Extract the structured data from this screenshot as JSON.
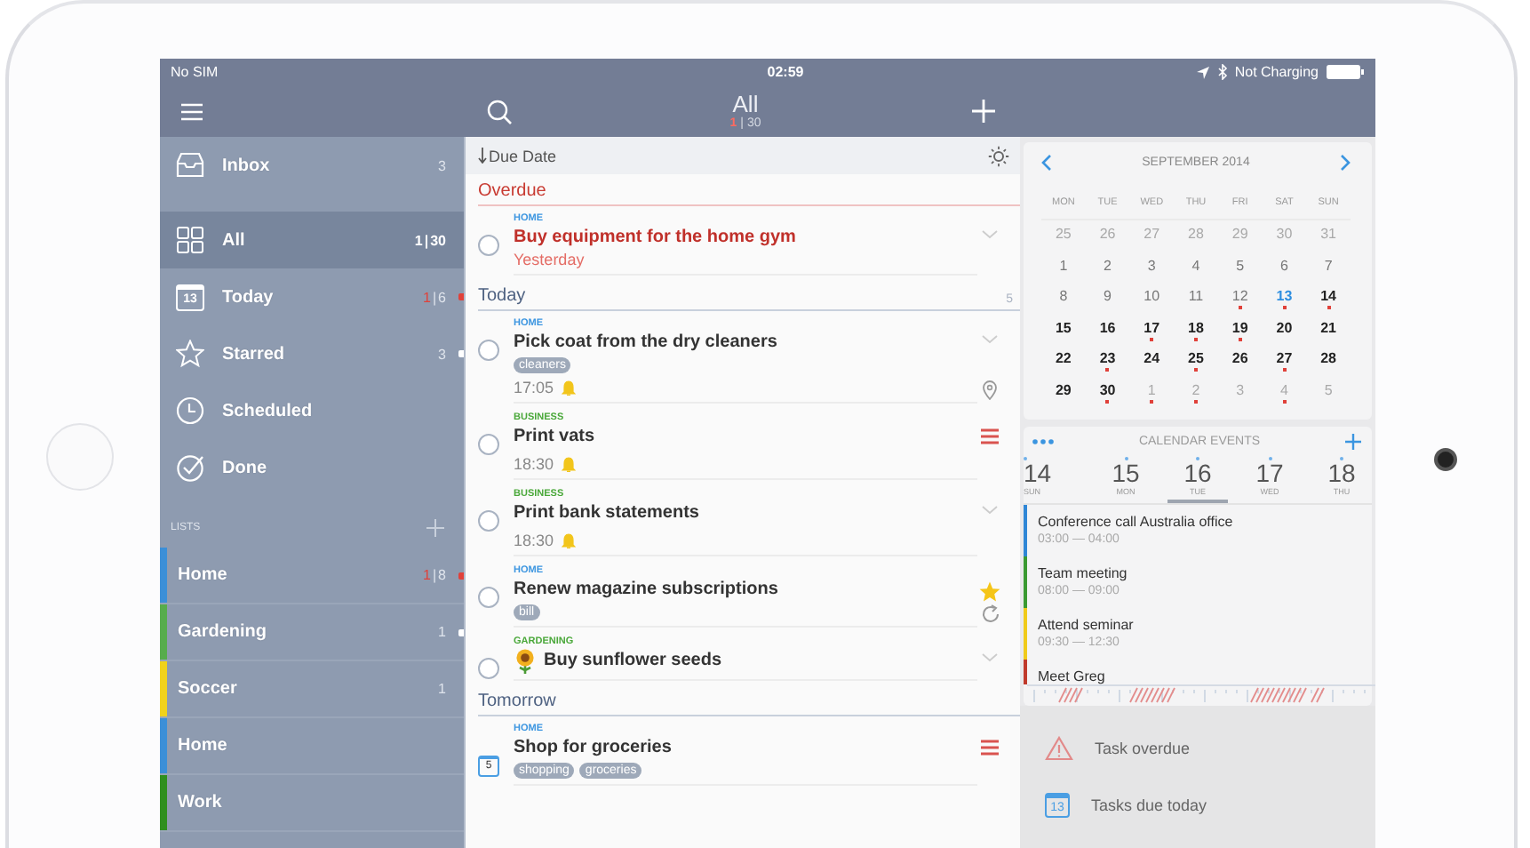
{
  "status_bar": {
    "carrier": "No SIM",
    "time": "02:59",
    "battery_text": "Not Charging"
  },
  "nav_bar": {
    "title": "All",
    "overdue": "1",
    "divider": "|",
    "count": "30"
  },
  "sidebar": {
    "items": [
      {
        "label": "Inbox",
        "selected": false,
        "count": "3",
        "overdue_marker": false,
        "count_marker": false
      },
      {
        "label": "All",
        "selected": true,
        "overdue": "1",
        "divider": "|",
        "count": "30",
        "overdue_marker": false,
        "count_marker": false
      },
      {
        "label": "Today",
        "icon_text": "13",
        "selected": false,
        "overdue": "1",
        "divider": "|",
        "count": "6",
        "overdue_marker": true,
        "count_marker": false
      },
      {
        "label": "Starred",
        "selected": false,
        "count": "3",
        "overdue_marker": false,
        "count_marker": true
      },
      {
        "label": "Scheduled",
        "selected": false,
        "overdue_marker": false,
        "count_marker": false
      },
      {
        "label": "Done",
        "selected": false,
        "overdue_marker": false,
        "count_marker": false
      }
    ],
    "lists_heading": "LISTS",
    "lists": [
      {
        "label": "Home",
        "color": "#3b8fd8",
        "selected": false,
        "overdue": "1",
        "divider": "|",
        "count": "8",
        "overdue_marker": true,
        "count_marker": false
      },
      {
        "label": "Gardening",
        "color": "#57ac4c",
        "selected": false,
        "count": "1",
        "overdue_marker": false,
        "count_marker": true
      },
      {
        "label": "Soccer",
        "color": "#f1d21b",
        "selected": false,
        "count": "1",
        "overdue_marker": false,
        "count_marker": false
      },
      {
        "label": "Home",
        "color": "#3b8fd8",
        "selected": false,
        "overdue_marker": false,
        "count_marker": false
      },
      {
        "label": "Work",
        "color": "#2f8f1f",
        "selected": false,
        "overdue_marker": false,
        "count_marker": false
      }
    ]
  },
  "sort_bar": {
    "label": "Due Date"
  },
  "sections": [
    {
      "title": "Overdue",
      "kind": "overdue",
      "tasks": [
        {
          "kind": "plain",
          "list": "HOME",
          "color": "#3b95e0",
          "title": "Buy equipment for the home gym",
          "checked": false,
          "overdue": true,
          "date": "Yesterday",
          "expandable": true,
          "has_note": false,
          "starred": false,
          "has_location": false,
          "repeats": false
        }
      ]
    },
    {
      "title": "Today",
      "kind": "normal",
      "count": "5",
      "tasks": [
        {
          "kind": "plain",
          "list": "HOME",
          "color": "#3b95e0",
          "title": "Pick coat from the dry cleaners",
          "checked": false,
          "overdue": false,
          "tags": [
            "cleaners"
          ],
          "time": "17:05",
          "reminder": true,
          "expandable": true,
          "has_note": false,
          "starred": false,
          "has_location": true,
          "repeats": false
        },
        {
          "kind": "plain",
          "list": "BUSINESS",
          "color": "#4aa83a",
          "title": "Print vats",
          "checked": false,
          "overdue": false,
          "time": "18:30",
          "reminder": true,
          "expandable": false,
          "has_note": true,
          "starred": false,
          "has_location": false,
          "repeats": false
        },
        {
          "kind": "plain",
          "list": "BUSINESS",
          "color": "#4aa83a",
          "title": "Print bank statements",
          "checked": false,
          "overdue": false,
          "time": "18:30",
          "reminder": true,
          "expandable": true,
          "has_note": false,
          "starred": false,
          "has_location": false,
          "repeats": false
        },
        {
          "kind": "plain",
          "list": "HOME",
          "color": "#3b95e0",
          "title": "Renew magazine subscriptions",
          "checked": false,
          "overdue": false,
          "tags": [
            "bill"
          ],
          "expandable": false,
          "has_note": false,
          "starred": true,
          "has_location": false,
          "repeats": true
        },
        {
          "kind": "flower",
          "list": "GARDENING",
          "color": "#4aa83a",
          "title": "Buy sunflower seeds",
          "checked": false,
          "overdue": false,
          "expandable": true,
          "has_note": false,
          "starred": false,
          "has_location": false,
          "repeats": false
        }
      ]
    },
    {
      "title": "Tomorrow",
      "kind": "normal",
      "tasks": [
        {
          "kind": "dated",
          "list": "HOME",
          "color": "#3b95e0",
          "title": "Shop for groceries",
          "checkbox_text": "5",
          "overdue": false,
          "tags": [
            "shopping",
            "groceries"
          ],
          "expandable": false,
          "has_note": true,
          "starred": false,
          "has_location": false,
          "repeats": false
        }
      ]
    }
  ],
  "calendar": {
    "month": "SEPTEMBER 2014",
    "weekdays": [
      "MON",
      "TUE",
      "WED",
      "THU",
      "FRI",
      "SAT",
      "SUN"
    ],
    "days": [
      {
        "day": "25",
        "kind": "outside",
        "has_events": false
      },
      {
        "day": "26",
        "kind": "outside",
        "has_events": false
      },
      {
        "day": "27",
        "kind": "outside",
        "has_events": false
      },
      {
        "day": "28",
        "kind": "outside",
        "has_events": false
      },
      {
        "day": "29",
        "kind": "outside",
        "has_events": false
      },
      {
        "day": "30",
        "kind": "outside",
        "has_events": false
      },
      {
        "day": "31",
        "kind": "outside",
        "has_events": false
      },
      {
        "day": "1",
        "kind": "past",
        "has_events": false
      },
      {
        "day": "2",
        "kind": "past",
        "has_events": false
      },
      {
        "day": "3",
        "kind": "past",
        "has_events": false
      },
      {
        "day": "4",
        "kind": "past",
        "has_events": false
      },
      {
        "day": "5",
        "kind": "past",
        "has_events": false
      },
      {
        "day": "6",
        "kind": "past",
        "has_events": false
      },
      {
        "day": "7",
        "kind": "past",
        "has_events": false
      },
      {
        "day": "8",
        "kind": "past",
        "has_events": false
      },
      {
        "day": "9",
        "kind": "past",
        "has_events": false
      },
      {
        "day": "10",
        "kind": "past",
        "has_events": false
      },
      {
        "day": "11",
        "kind": "past",
        "has_events": false
      },
      {
        "day": "12",
        "kind": "past",
        "has_events": true
      },
      {
        "day": "13",
        "kind": "today",
        "has_events": true
      },
      {
        "day": "14",
        "kind": "future",
        "has_events": true
      },
      {
        "day": "15",
        "kind": "future",
        "has_events": false
      },
      {
        "day": "16",
        "kind": "future",
        "has_events": false
      },
      {
        "day": "17",
        "kind": "future",
        "has_events": true
      },
      {
        "day": "18",
        "kind": "future",
        "has_events": true
      },
      {
        "day": "19",
        "kind": "future",
        "has_events": true
      },
      {
        "day": "20",
        "kind": "future",
        "has_events": false
      },
      {
        "day": "21",
        "kind": "future",
        "has_events": false
      },
      {
        "day": "22",
        "kind": "future",
        "has_events": false
      },
      {
        "day": "23",
        "kind": "future",
        "has_events": true
      },
      {
        "day": "24",
        "kind": "future",
        "has_events": false
      },
      {
        "day": "25",
        "kind": "future",
        "has_events": true
      },
      {
        "day": "26",
        "kind": "future",
        "has_events": false
      },
      {
        "day": "27",
        "kind": "future",
        "has_events": true
      },
      {
        "day": "28",
        "kind": "future",
        "has_events": false
      },
      {
        "day": "29",
        "kind": "future",
        "has_events": false
      },
      {
        "day": "30",
        "kind": "future",
        "has_events": true
      },
      {
        "day": "1",
        "kind": "outside",
        "has_events": true
      },
      {
        "day": "2",
        "kind": "outside",
        "has_events": true
      },
      {
        "day": "3",
        "kind": "outside",
        "has_events": false
      },
      {
        "day": "4",
        "kind": "outside",
        "has_events": true
      },
      {
        "day": "5",
        "kind": "outside",
        "has_events": false
      }
    ]
  },
  "events": {
    "heading": "CALENDAR EVENTS",
    "days": [
      {
        "day": "14",
        "weekday": "SUN",
        "selected": false
      },
      {
        "day": "15",
        "weekday": "MON",
        "selected": false
      },
      {
        "day": "16",
        "weekday": "TUE",
        "selected": true
      },
      {
        "day": "17",
        "weekday": "WED",
        "selected": false
      },
      {
        "day": "18",
        "weekday": "THU",
        "selected": false
      }
    ],
    "items": [
      {
        "title": "Conference call Australia office",
        "time": "03:00 — 04:00",
        "color": "#2f86d6"
      },
      {
        "title": "Team meeting",
        "time": "08:00 — 09:00",
        "color": "#3a9a32"
      },
      {
        "title": "Attend seminar",
        "time": "09:30 — 12:30",
        "color": "#f0cb1a"
      },
      {
        "title": "Meet Greg",
        "color": "#c0392b"
      }
    ]
  },
  "notifications": [
    {
      "kind": "overdue",
      "label": "Task overdue"
    },
    {
      "kind": "today",
      "label": "Tasks due today",
      "icon_text": "13"
    }
  ]
}
